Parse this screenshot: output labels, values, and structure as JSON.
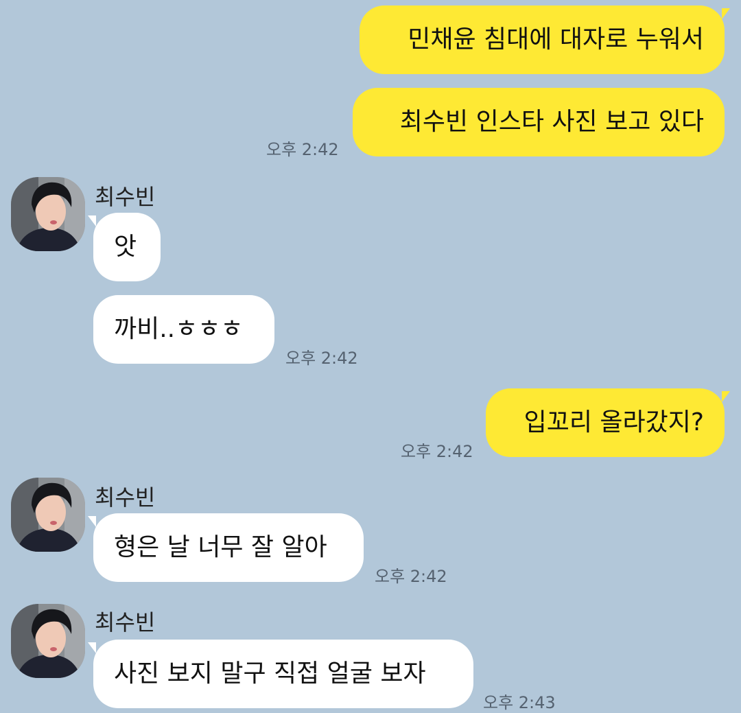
{
  "chat": {
    "sender_name": "최수빈",
    "messages": [
      {
        "from": "me",
        "text": "민채윤 침대에 대자로 누워서"
      },
      {
        "from": "me",
        "text": "최수빈 인스타 사진 보고 있다",
        "time": "오후 2:42"
      },
      {
        "from": "them",
        "text": "앗"
      },
      {
        "from": "them",
        "text": "까비..ㅎㅎㅎ",
        "time": "오후 2:42"
      },
      {
        "from": "me",
        "text": "입꼬리 올라갔지?",
        "time": "오후 2:42"
      },
      {
        "from": "them",
        "text": "형은 날 너무 잘 알아",
        "time": "오후 2:42"
      },
      {
        "from": "them",
        "text": "사진 보지 말구 직접 얼굴 보자",
        "time": "오후 2:43"
      }
    ]
  },
  "colors": {
    "background": "#b2c7d9",
    "my_bubble": "#fee934",
    "their_bubble": "#ffffff",
    "timestamp": "#556270"
  },
  "icons": {
    "avatar": "profile-photo"
  }
}
